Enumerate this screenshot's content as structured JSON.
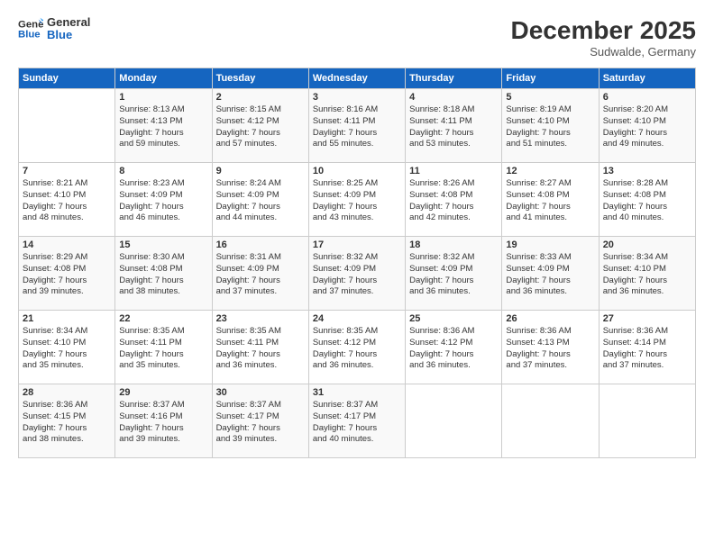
{
  "logo": {
    "line1": "General",
    "line2": "Blue"
  },
  "title": "December 2025",
  "subtitle": "Sudwalde, Germany",
  "weekdays": [
    "Sunday",
    "Monday",
    "Tuesday",
    "Wednesday",
    "Thursday",
    "Friday",
    "Saturday"
  ],
  "weeks": [
    [
      {
        "day": "",
        "info": ""
      },
      {
        "day": "1",
        "info": "Sunrise: 8:13 AM\nSunset: 4:13 PM\nDaylight: 7 hours\nand 59 minutes."
      },
      {
        "day": "2",
        "info": "Sunrise: 8:15 AM\nSunset: 4:12 PM\nDaylight: 7 hours\nand 57 minutes."
      },
      {
        "day": "3",
        "info": "Sunrise: 8:16 AM\nSunset: 4:11 PM\nDaylight: 7 hours\nand 55 minutes."
      },
      {
        "day": "4",
        "info": "Sunrise: 8:18 AM\nSunset: 4:11 PM\nDaylight: 7 hours\nand 53 minutes."
      },
      {
        "day": "5",
        "info": "Sunrise: 8:19 AM\nSunset: 4:10 PM\nDaylight: 7 hours\nand 51 minutes."
      },
      {
        "day": "6",
        "info": "Sunrise: 8:20 AM\nSunset: 4:10 PM\nDaylight: 7 hours\nand 49 minutes."
      }
    ],
    [
      {
        "day": "7",
        "info": "Sunrise: 8:21 AM\nSunset: 4:10 PM\nDaylight: 7 hours\nand 48 minutes."
      },
      {
        "day": "8",
        "info": "Sunrise: 8:23 AM\nSunset: 4:09 PM\nDaylight: 7 hours\nand 46 minutes."
      },
      {
        "day": "9",
        "info": "Sunrise: 8:24 AM\nSunset: 4:09 PM\nDaylight: 7 hours\nand 44 minutes."
      },
      {
        "day": "10",
        "info": "Sunrise: 8:25 AM\nSunset: 4:09 PM\nDaylight: 7 hours\nand 43 minutes."
      },
      {
        "day": "11",
        "info": "Sunrise: 8:26 AM\nSunset: 4:08 PM\nDaylight: 7 hours\nand 42 minutes."
      },
      {
        "day": "12",
        "info": "Sunrise: 8:27 AM\nSunset: 4:08 PM\nDaylight: 7 hours\nand 41 minutes."
      },
      {
        "day": "13",
        "info": "Sunrise: 8:28 AM\nSunset: 4:08 PM\nDaylight: 7 hours\nand 40 minutes."
      }
    ],
    [
      {
        "day": "14",
        "info": "Sunrise: 8:29 AM\nSunset: 4:08 PM\nDaylight: 7 hours\nand 39 minutes."
      },
      {
        "day": "15",
        "info": "Sunrise: 8:30 AM\nSunset: 4:08 PM\nDaylight: 7 hours\nand 38 minutes."
      },
      {
        "day": "16",
        "info": "Sunrise: 8:31 AM\nSunset: 4:09 PM\nDaylight: 7 hours\nand 37 minutes."
      },
      {
        "day": "17",
        "info": "Sunrise: 8:32 AM\nSunset: 4:09 PM\nDaylight: 7 hours\nand 37 minutes."
      },
      {
        "day": "18",
        "info": "Sunrise: 8:32 AM\nSunset: 4:09 PM\nDaylight: 7 hours\nand 36 minutes."
      },
      {
        "day": "19",
        "info": "Sunrise: 8:33 AM\nSunset: 4:09 PM\nDaylight: 7 hours\nand 36 minutes."
      },
      {
        "day": "20",
        "info": "Sunrise: 8:34 AM\nSunset: 4:10 PM\nDaylight: 7 hours\nand 36 minutes."
      }
    ],
    [
      {
        "day": "21",
        "info": "Sunrise: 8:34 AM\nSunset: 4:10 PM\nDaylight: 7 hours\nand 35 minutes."
      },
      {
        "day": "22",
        "info": "Sunrise: 8:35 AM\nSunset: 4:11 PM\nDaylight: 7 hours\nand 35 minutes."
      },
      {
        "day": "23",
        "info": "Sunrise: 8:35 AM\nSunset: 4:11 PM\nDaylight: 7 hours\nand 36 minutes."
      },
      {
        "day": "24",
        "info": "Sunrise: 8:35 AM\nSunset: 4:12 PM\nDaylight: 7 hours\nand 36 minutes."
      },
      {
        "day": "25",
        "info": "Sunrise: 8:36 AM\nSunset: 4:12 PM\nDaylight: 7 hours\nand 36 minutes."
      },
      {
        "day": "26",
        "info": "Sunrise: 8:36 AM\nSunset: 4:13 PM\nDaylight: 7 hours\nand 37 minutes."
      },
      {
        "day": "27",
        "info": "Sunrise: 8:36 AM\nSunset: 4:14 PM\nDaylight: 7 hours\nand 37 minutes."
      }
    ],
    [
      {
        "day": "28",
        "info": "Sunrise: 8:36 AM\nSunset: 4:15 PM\nDaylight: 7 hours\nand 38 minutes."
      },
      {
        "day": "29",
        "info": "Sunrise: 8:37 AM\nSunset: 4:16 PM\nDaylight: 7 hours\nand 39 minutes."
      },
      {
        "day": "30",
        "info": "Sunrise: 8:37 AM\nSunset: 4:17 PM\nDaylight: 7 hours\nand 39 minutes."
      },
      {
        "day": "31",
        "info": "Sunrise: 8:37 AM\nSunset: 4:17 PM\nDaylight: 7 hours\nand 40 minutes."
      },
      {
        "day": "",
        "info": ""
      },
      {
        "day": "",
        "info": ""
      },
      {
        "day": "",
        "info": ""
      }
    ]
  ]
}
